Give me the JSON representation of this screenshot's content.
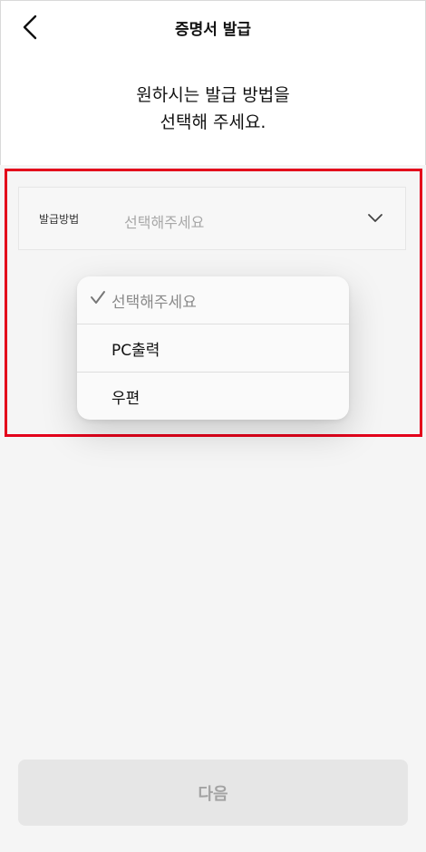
{
  "header": {
    "title": "증명서 발급",
    "back_icon": "chevron-left-icon"
  },
  "intro": {
    "line1": "원하시는 발급 방법을",
    "line2": "선택해 주세요."
  },
  "field": {
    "label": "발급방법",
    "value": "선택해주세요",
    "icon": "chevron-down-icon"
  },
  "dropdown": {
    "options": [
      {
        "label": "선택해주세요",
        "selected": true
      },
      {
        "label": "PC출력",
        "selected": false
      },
      {
        "label": "우편",
        "selected": false
      }
    ]
  },
  "footer": {
    "next_label": "다음"
  },
  "colors": {
    "highlight": "#e3001b",
    "background_gray": "#f5f5f5",
    "button_disabled_bg": "#e6e6e6",
    "button_disabled_text": "#a3a3a3"
  }
}
